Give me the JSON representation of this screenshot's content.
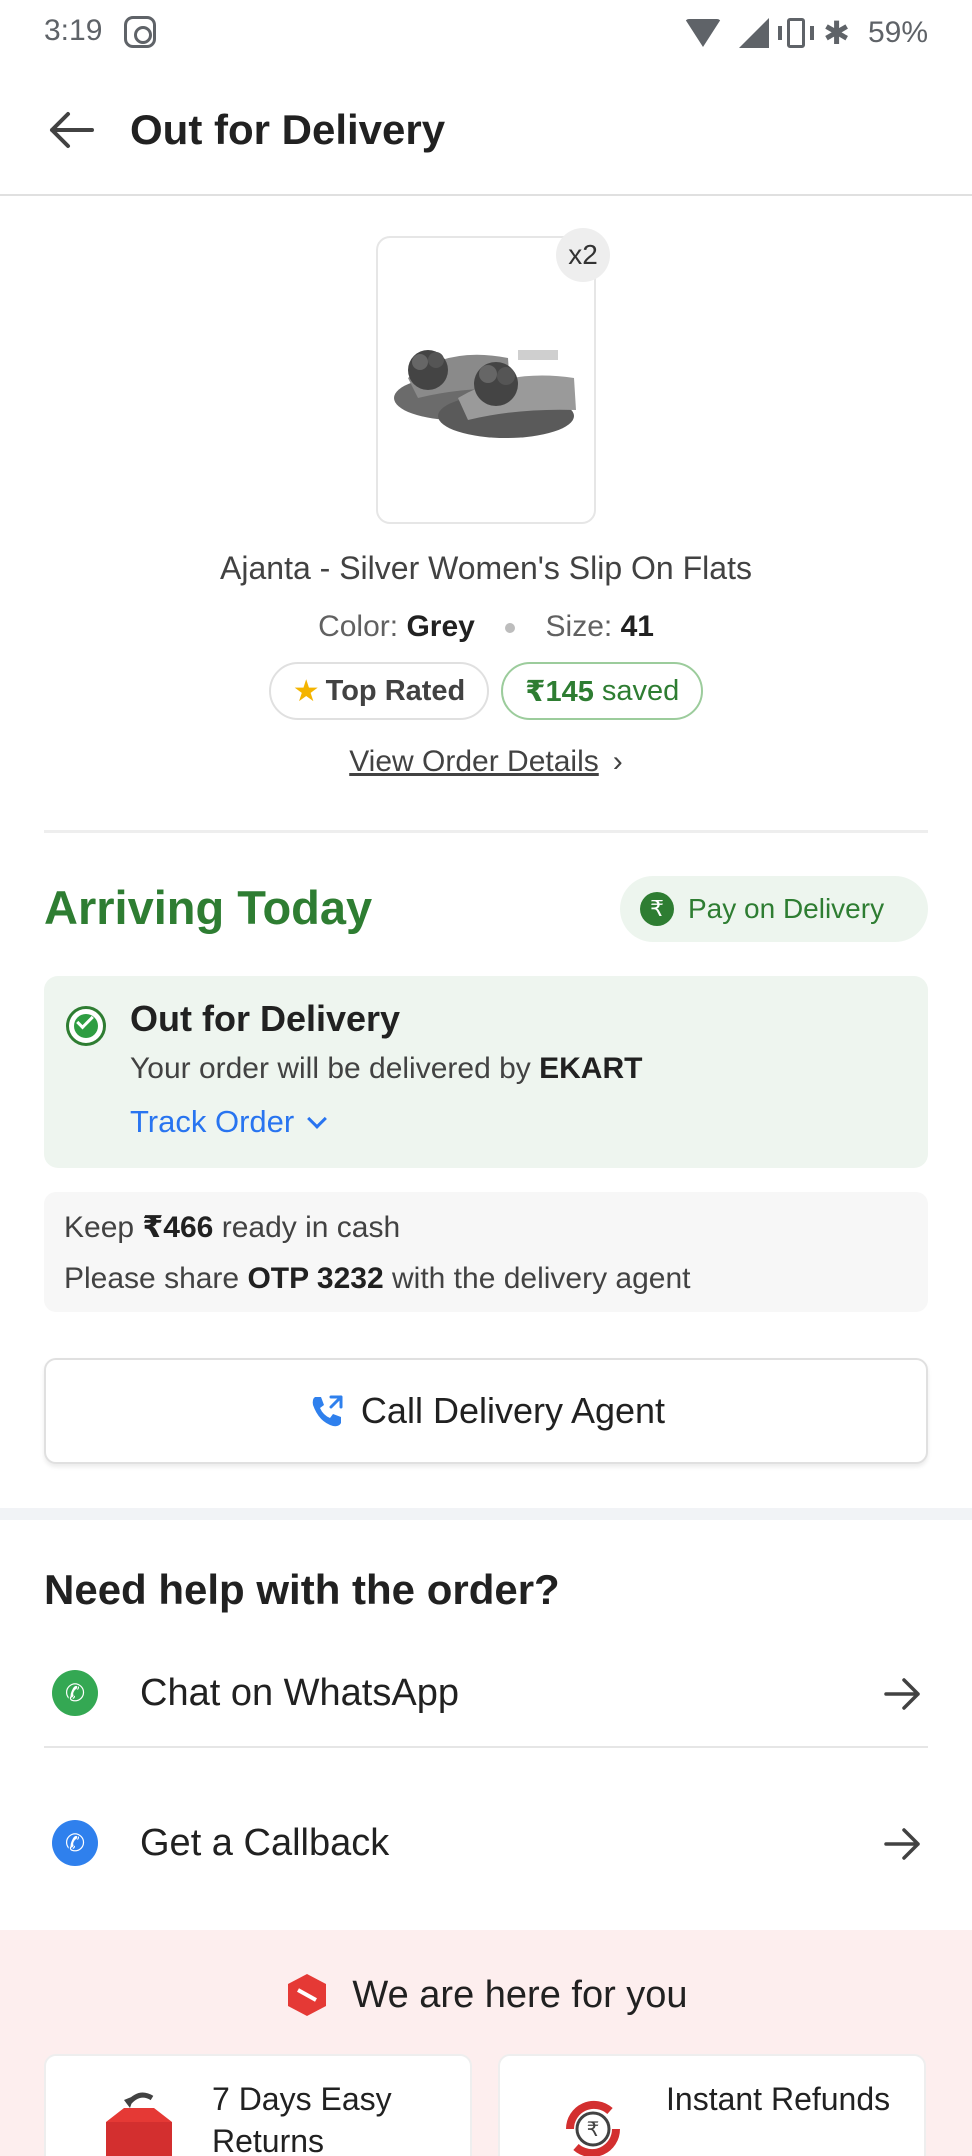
{
  "status_bar": {
    "time": "3:19",
    "battery": "59%"
  },
  "app_bar": {
    "title": "Out for Delivery"
  },
  "product": {
    "quantity_badge": "x2",
    "name": "Ajanta - Silver Women's Slip On Flats",
    "color_label": "Color:",
    "color_value": "Grey",
    "size_label": "Size:",
    "size_value": "41",
    "top_rated_label": "Top Rated",
    "saved_amount": "₹145",
    "saved_label": "saved",
    "view_details_label": "View Order Details"
  },
  "delivery": {
    "arriving_label": "Arriving Today",
    "payment_label": "Pay on Delivery",
    "status_title": "Out for Delivery",
    "status_sub_prefix": "Your order will be delivered by",
    "courier": "EKART",
    "track_label": "Track Order",
    "cash_prefix": "Keep",
    "cash_amount": "₹466",
    "cash_suffix": "ready in cash",
    "otp_prefix": "Please share",
    "otp_value": "OTP 3232",
    "otp_suffix": "with the delivery agent",
    "call_button_label": "Call Delivery Agent"
  },
  "help": {
    "title": "Need help with the order?",
    "items": [
      {
        "label": "Chat on WhatsApp",
        "icon": "whatsapp-icon"
      },
      {
        "label": "Get a Callback",
        "icon": "phone-icon"
      }
    ]
  },
  "footer": {
    "title": "We are here for you",
    "features": [
      {
        "label": "7 Days Easy Returns",
        "icon": "return-box-icon"
      },
      {
        "label": "Instant Refunds",
        "icon": "refund-icon"
      }
    ]
  },
  "colors": {
    "accent_green": "#2e7d32",
    "link_blue": "#2874f0",
    "footer_bg": "#fdeeee"
  }
}
